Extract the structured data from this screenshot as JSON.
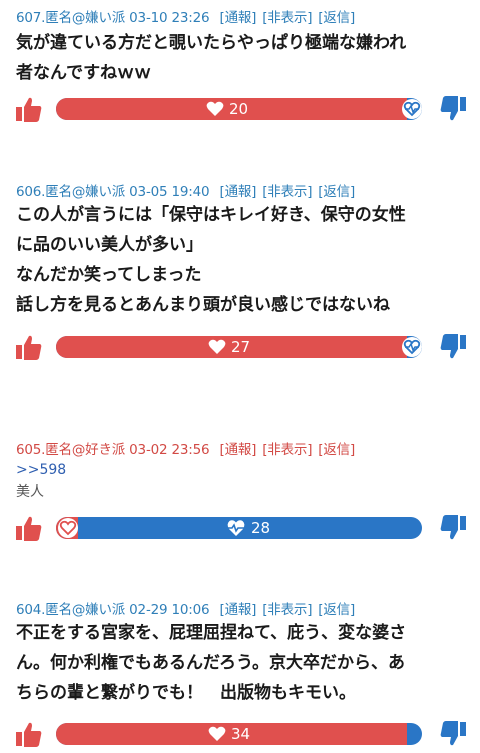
{
  "comments": [
    {
      "number": "607.",
      "name": "匿名@嫌い派",
      "date": "03-10 23:26",
      "links": [
        "[通報]",
        "[非表示]",
        "[返信]"
      ],
      "lines": [
        "気が違ている方だと覗いたらやっぱり極端な嫌われ",
        "者なんですねｗｗ"
      ],
      "votes": {
        "leading": "good",
        "count": "20",
        "good_fraction": 0.96
      }
    },
    {
      "number": "606.",
      "name": "匿名@嫌い派",
      "date": "03-05 19:40",
      "links": [
        "[通報]",
        "[非表示]",
        "[返信]"
      ],
      "lines": [
        "この人が言うには「保守はキレイ好き、保守の女性",
        "に品のいい美人が多い」",
        "なんだか笑ってしまった",
        "話し方を見るとあんまり頭が良い感じではないね"
      ],
      "votes": {
        "leading": "good",
        "count": "27",
        "good_fraction": 0.96
      }
    },
    {
      "number": "605.",
      "name": "匿名@好き派",
      "date": "03-02 23:56",
      "links": [
        "[通報]",
        "[非表示]",
        "[返信]"
      ],
      "reply_to": ">>598",
      "text": "美人",
      "votes": {
        "leading": "bad",
        "count": "28",
        "good_fraction": 0.06
      }
    },
    {
      "number": "604.",
      "name": "匿名@嫌い派",
      "date": "02-29 10:06",
      "links": [
        "[通報]",
        "[非表示]",
        "[返信]"
      ],
      "lines": [
        "不正をする宮家を、屁理屈捏ねて、庇う、変な婆さ",
        "ん。何か利権でもあるんだろう。京大卒だから、あ",
        "ちらの輩と繋がりでも！　出版物もキモい。"
      ],
      "votes": {
        "leading": "good",
        "count": "34",
        "good_fraction": 0.96
      }
    }
  ],
  "icons": {
    "good": "thumbs-up-icon",
    "bad": "thumbs-down-icon",
    "heart": "heart-icon",
    "heartbeat": "heart-pulse-icon"
  },
  "colors": {
    "good": "#e0504e",
    "bad": "#2a76c6",
    "name_dislike": "#2f7fb8",
    "name_like": "#d24a45"
  }
}
